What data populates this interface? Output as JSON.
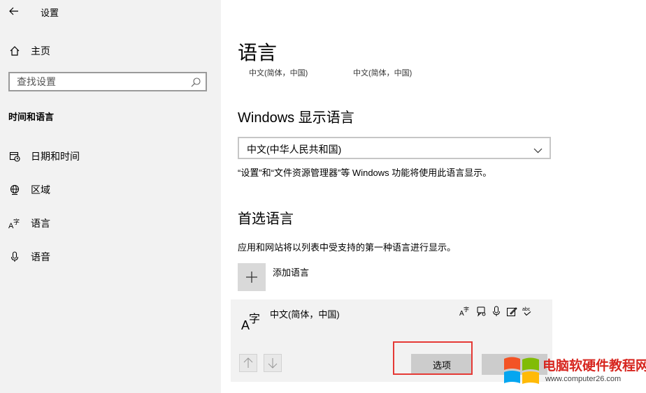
{
  "window": {
    "title": "设置"
  },
  "sidebar": {
    "home_label": "主页",
    "search_placeholder": "查找设置",
    "section_title": "时间和语言",
    "items": [
      {
        "label": "日期和时间",
        "icon": "calendar-clock-icon"
      },
      {
        "label": "区域",
        "icon": "globe-icon"
      },
      {
        "label": "语言",
        "icon": "language-icon"
      },
      {
        "label": "语音",
        "icon": "microphone-icon"
      }
    ]
  },
  "main": {
    "title": "语言",
    "subtitles": [
      "中文(简体，中国)",
      "中文(简体，中国)"
    ],
    "display_language": {
      "heading": "Windows 显示语言",
      "selected": "中文(中华人民共和国)",
      "note": "“设置”和“文件资源管理器”等 Windows 功能将使用此语言显示。"
    },
    "preferred": {
      "heading": "首选语言",
      "description": "应用和网站将以列表中受支持的第一种语言进行显示。",
      "add_label": "添加语言",
      "language": {
        "name": "中文(简体，中国)",
        "glyph_latin": "A",
        "glyph_cjk": "字",
        "features": [
          "display-language-icon",
          "speech-icon",
          "voice-input-icon",
          "handwriting-icon",
          "spellcheck-icon"
        ],
        "options_label": "选项"
      }
    }
  },
  "watermark": {
    "brand": "电脑软硬件教程网",
    "url": "www.computer26.com",
    "colors": [
      "#f35325",
      "#81bc06",
      "#05a6f0",
      "#ffba08"
    ]
  },
  "colors": {
    "highlight": "#e53935"
  }
}
